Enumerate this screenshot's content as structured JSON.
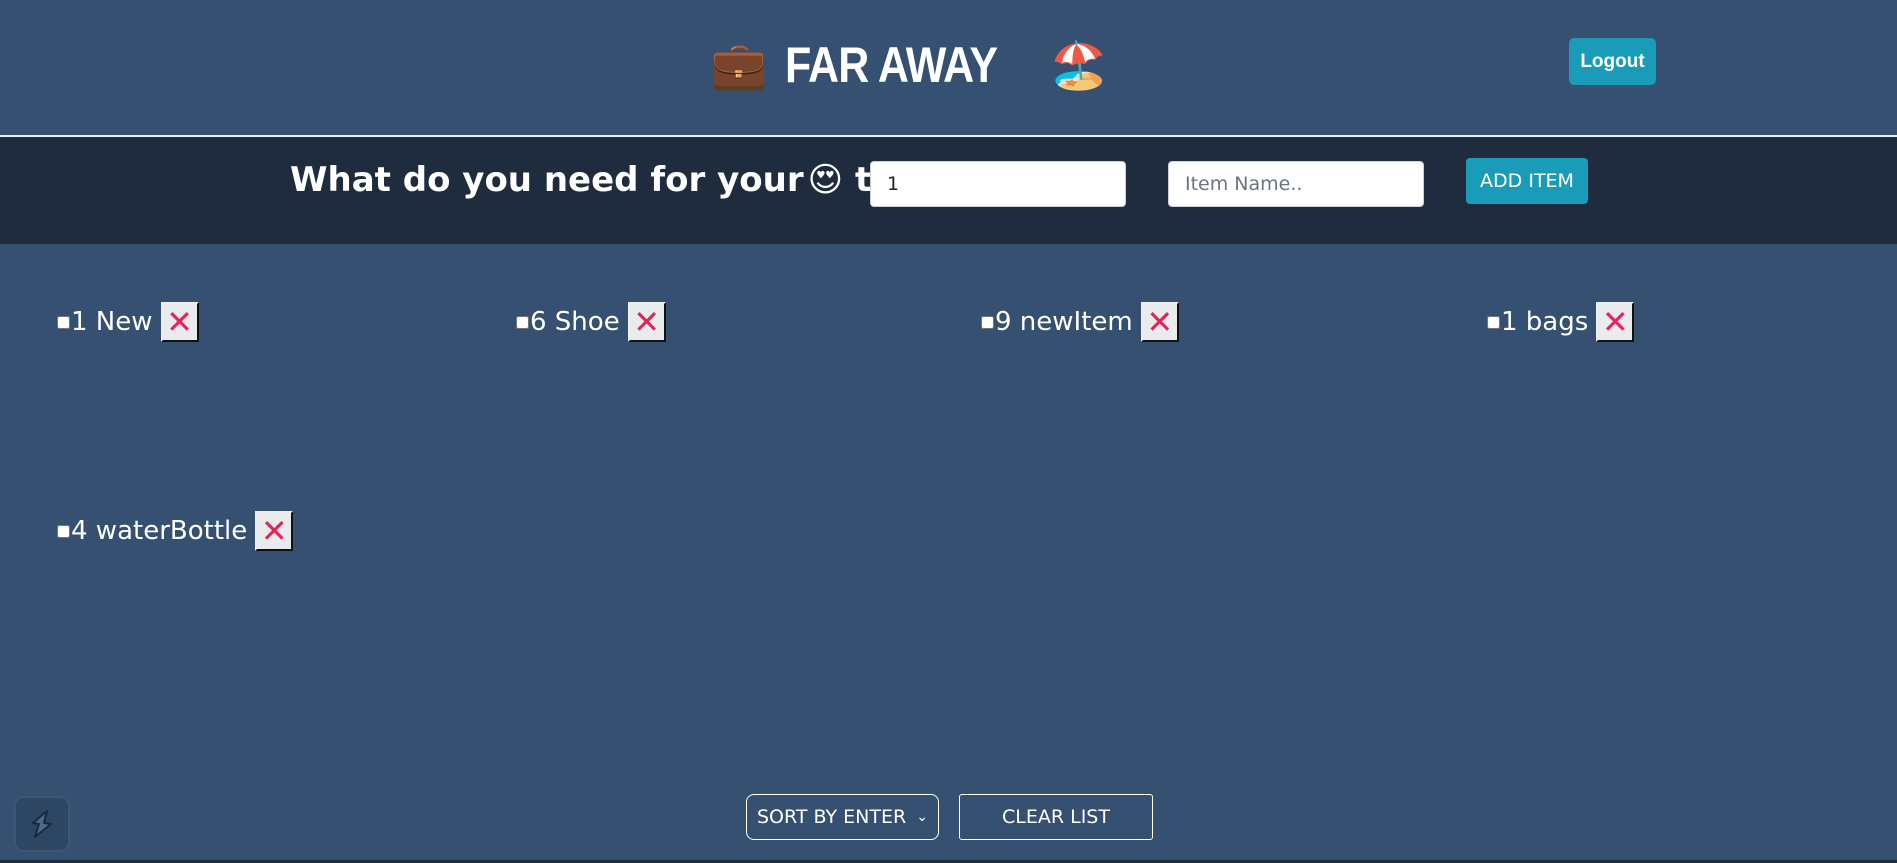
{
  "header": {
    "title": "FAR AWAY",
    "left_emoji": "💼",
    "right_emoji": "🏖️",
    "logout_label": "Logout"
  },
  "form": {
    "question_prefix": "What do you need for your",
    "question_emoji": "😍",
    "question_suffix": "trip?",
    "quantity_value": "1",
    "name_placeholder": "Item Name..",
    "add_label": "ADD ITEM"
  },
  "items": [
    {
      "label": "1 New",
      "checked": false
    },
    {
      "label": "6 Shoe",
      "checked": false
    },
    {
      "label": "9 newItem",
      "checked": false
    },
    {
      "label": "1 bags",
      "checked": false
    },
    {
      "label": "4 waterBottle",
      "checked": false
    }
  ],
  "delete_glyph": "✕",
  "footer": {
    "sort_value": "SORT BY ENTER D",
    "clear_label": "CLEAR LIST"
  },
  "colors": {
    "background": "#355070",
    "form_bar": "#1f2c3e",
    "accent": "#1a9cb8",
    "delete_x": "#e3245a"
  }
}
